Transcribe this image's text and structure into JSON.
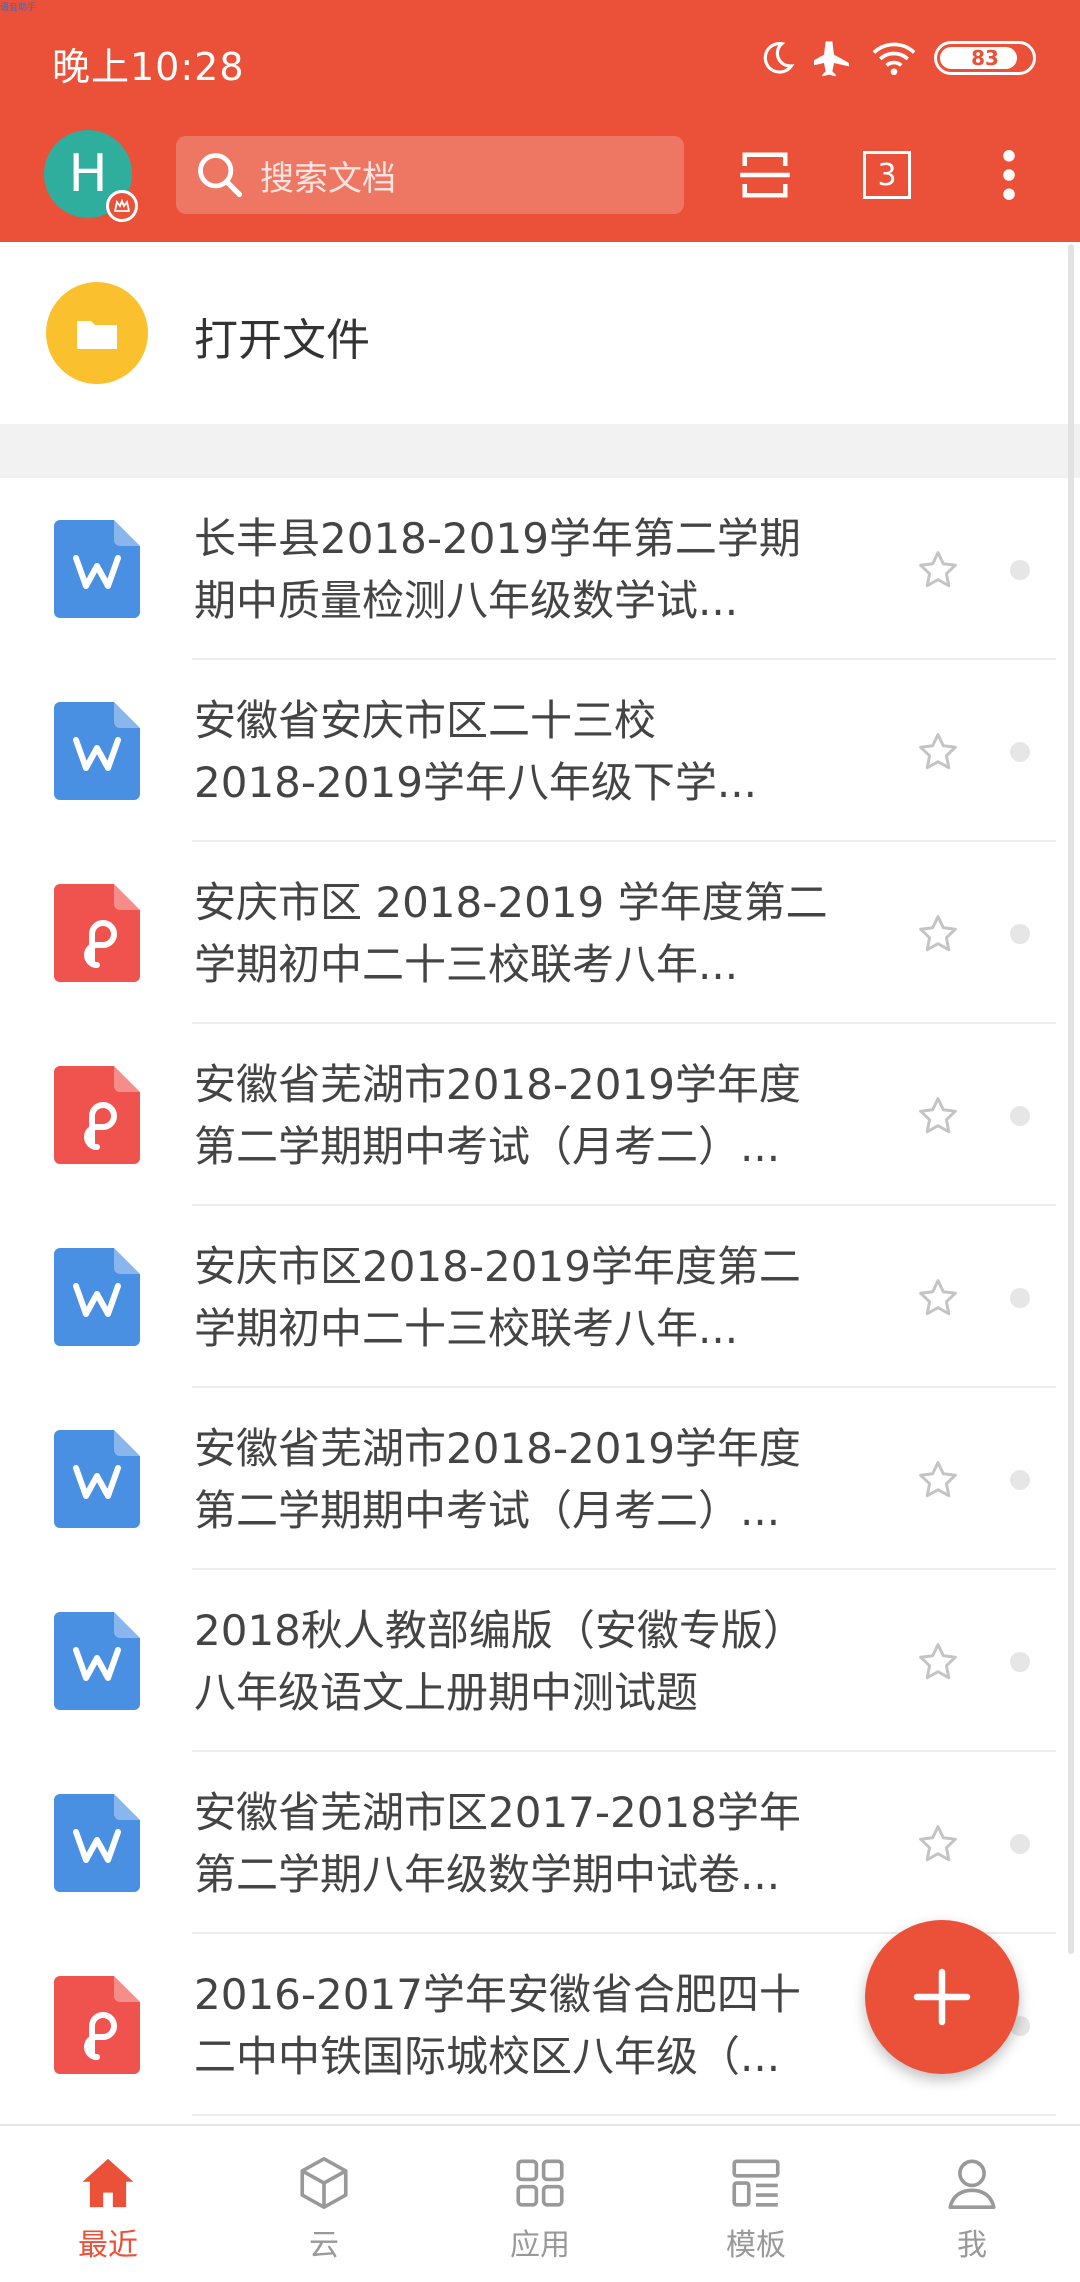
{
  "status_bar": {
    "time": "晚上10:28",
    "battery": "83"
  },
  "header": {
    "avatar_letter": "H",
    "search_placeholder": "搜索文档",
    "tab_count": "3"
  },
  "open_file": {
    "label": "打开文件"
  },
  "files": [
    {
      "type": "word",
      "line1": "长丰县2018-2019学年第二学期",
      "line2": "期中质量检测八年级数学试..."
    },
    {
      "type": "word",
      "line1": "安徽省安庆市区二十三校",
      "line2": "2018-2019学年八年级下学..."
    },
    {
      "type": "pdf",
      "line1": "安庆市区 2018-2019 学年度第二",
      "line2": "学期初中二十三校联考八年..."
    },
    {
      "type": "pdf",
      "line1": "安徽省芜湖市2018-2019学年度",
      "line2": "第二学期期中考试（月考二）..."
    },
    {
      "type": "word",
      "line1": "安庆市区2018-2019学年度第二",
      "line2": "学期初中二十三校联考八年..."
    },
    {
      "type": "word",
      "line1": "安徽省芜湖市2018-2019学年度",
      "line2": "第二学期期中考试（月考二）..."
    },
    {
      "type": "word",
      "line1": "2018秋人教部编版（安徽专版）",
      "line2": "八年级语文上册期中测试题"
    },
    {
      "type": "word",
      "line1": "安徽省芜湖市区2017-2018学年",
      "line2": "第二学期八年级数学期中试卷..."
    },
    {
      "type": "pdf",
      "line1": "2016-2017学年安徽省合肥四十",
      "line2": "二中中铁国际城校区八年级（..."
    }
  ],
  "bottom_nav": [
    {
      "label": "最近",
      "icon": "home-icon",
      "active": true
    },
    {
      "label": "云",
      "icon": "cube-icon",
      "active": false
    },
    {
      "label": "应用",
      "icon": "apps-grid-icon",
      "active": false
    },
    {
      "label": "模板",
      "icon": "template-icon",
      "active": false
    },
    {
      "label": "我",
      "icon": "person-icon",
      "active": false
    }
  ],
  "colors": {
    "accent": "#EA5138",
    "word_icon": "#4A90E2",
    "pdf_icon": "#F0524E",
    "folder": "#FBC02D",
    "avatar": "#2FAE9E"
  },
  "watermark": "语音助手"
}
